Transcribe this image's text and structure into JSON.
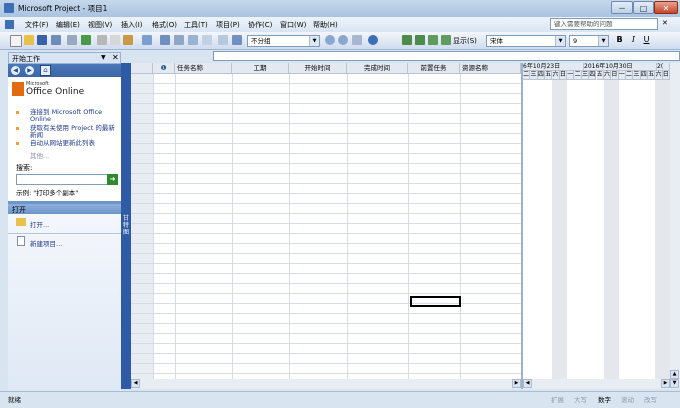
{
  "window": {
    "title": "Microsoft Project - 项目1",
    "controls": [
      "－",
      "□",
      "✕"
    ]
  },
  "menu": {
    "items": [
      "文件(F)",
      "编辑(E)",
      "视图(V)",
      "插入(I)",
      "格式(O)",
      "工具(T)",
      "项目(P)",
      "协作(C)",
      "窗口(W)",
      "帮助(H)"
    ],
    "help_placeholder": "键入需要帮助的问题"
  },
  "toolbar": {
    "group_value": "不分组",
    "show_label": "显示(S)",
    "font_value": "宋体",
    "size_value": "9",
    "bold": "B",
    "italic": "I",
    "underline": "U"
  },
  "taskpane": {
    "title": "开始工作",
    "office_small": "Microsoft",
    "office_brand": "Office Online",
    "links": [
      "连接到 Microsoft Office Online",
      "获取有关使用 Project 的最新新闻",
      "自动从网站更新此列表"
    ],
    "more": "其他...",
    "search_label": "搜索:",
    "example": "示例: \"打印多个副本\"",
    "open_section": "打开",
    "open_link": "打开...",
    "new_link": "新建项目..."
  },
  "view_bar_label": "甘特图",
  "sheet": {
    "columns": [
      "",
      "❶",
      "任务名称",
      "工期",
      "开始时间",
      "完成时间",
      "前置任务",
      "资源名称"
    ]
  },
  "gantt": {
    "weeks": [
      "6年10月23日",
      "2016年10月30日",
      "2("
    ],
    "days": [
      "二",
      "三",
      "四",
      "五",
      "六",
      "日",
      "一",
      "二",
      "三",
      "四",
      "五",
      "六",
      "日",
      "一",
      "二",
      "三",
      "四",
      "五",
      "六",
      "日"
    ]
  },
  "status": {
    "ready": "就绪",
    "ext": "扩展",
    "caps": "大写",
    "num": "数字",
    "scroll": "滚动",
    "ovr": "改写"
  }
}
